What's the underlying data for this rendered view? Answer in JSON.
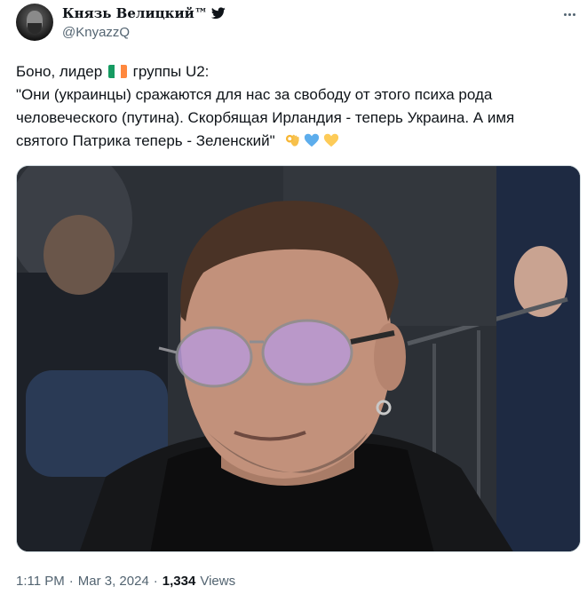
{
  "author": {
    "display_name": "Князь Велицкий™",
    "handle": "@KnyazzQ",
    "avatar": "avatar",
    "verified_icon": "twitter-bird-icon"
  },
  "tweet": {
    "line1_before_flag": "Боно, лидер",
    "flag_icon": "ireland-flag-emoji",
    "line1_after_flag": "группы U2:",
    "line2": "\"Они (украинцы) сражаются для нас за свободу от этого психа рода",
    "line3": "человеческого (путина). Скорбящая Ирландия - теперь Украина. А имя",
    "line4": "святого Патрика теперь - Зеленский\"",
    "emojis": [
      "ok-hand-emoji",
      "blue-heart-emoji",
      "yellow-heart-emoji"
    ]
  },
  "media": {
    "subject_icon": "photo-of-man-with-tinted-glasses"
  },
  "meta": {
    "time": "1:11 PM",
    "separator1": "·",
    "date": "Mar 3, 2024",
    "separator2": "·",
    "views_count": "1,334",
    "views_label": "Views"
  },
  "colors": {
    "text": "#0f1419",
    "secondary": "#536471",
    "border": "#cfd9de"
  }
}
